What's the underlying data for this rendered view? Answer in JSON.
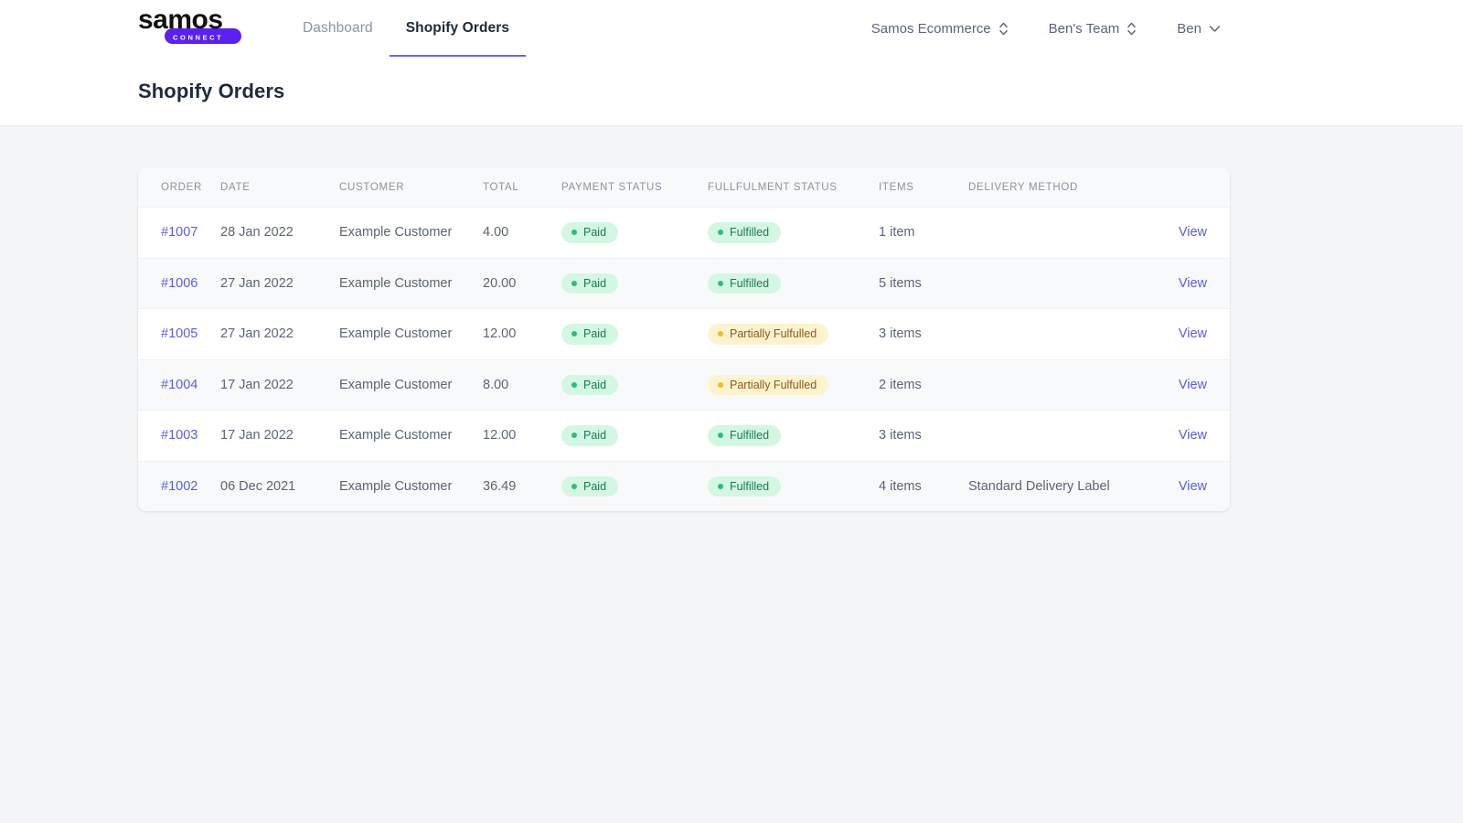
{
  "brand": {
    "name": "samos",
    "tagline": "C O N N E C T",
    "tagline_plain": "CONNECT",
    "logo_purple": "#5b21f0"
  },
  "nav": {
    "tabs": [
      {
        "label": "Dashboard",
        "active": false
      },
      {
        "label": "Shopify Orders",
        "active": true
      }
    ],
    "active_underline_color": "#6366f1"
  },
  "account": {
    "store_selector": {
      "label": "Samos Ecommerce",
      "icon": "up-down-chevron-icon"
    },
    "team_selector": {
      "label": "Ben's Team",
      "icon": "up-down-chevron-icon"
    },
    "user_menu": {
      "label": "Ben",
      "icon": "chevron-down-icon"
    }
  },
  "page": {
    "title": "Shopify Orders"
  },
  "table": {
    "columns": [
      "ORDER",
      "DATE",
      "CUSTOMER",
      "TOTAL",
      "PAYMENT STATUS",
      "FULLFULMENT STATUS",
      "ITEMS",
      "DELIVERY METHOD",
      ""
    ],
    "action_label": "View",
    "rows": [
      {
        "order": "#1007",
        "date": "28 Jan 2022",
        "customer": "Example Customer",
        "total": "4.00",
        "payment_status": "Paid",
        "payment_tone": "green",
        "fulfilment_status": "Fulfilled",
        "fulfilment_tone": "green",
        "items": "1 item",
        "delivery_method": "",
        "action": "View"
      },
      {
        "order": "#1006",
        "date": "27 Jan 2022",
        "customer": "Example Customer",
        "total": "20.00",
        "payment_status": "Paid",
        "payment_tone": "green",
        "fulfilment_status": "Fulfilled",
        "fulfilment_tone": "green",
        "items": "5 items",
        "delivery_method": "",
        "action": "View"
      },
      {
        "order": "#1005",
        "date": "27 Jan 2022",
        "customer": "Example Customer",
        "total": "12.00",
        "payment_status": "Paid",
        "payment_tone": "green",
        "fulfilment_status": "Partially Fulfulled",
        "fulfilment_tone": "amber",
        "items": "3 items",
        "delivery_method": "",
        "action": "View"
      },
      {
        "order": "#1004",
        "date": "17 Jan 2022",
        "customer": "Example Customer",
        "total": "8.00",
        "payment_status": "Paid",
        "payment_tone": "green",
        "fulfilment_status": "Partially Fulfulled",
        "fulfilment_tone": "amber",
        "items": "2 items",
        "delivery_method": "",
        "action": "View"
      },
      {
        "order": "#1003",
        "date": "17 Jan 2022",
        "customer": "Example Customer",
        "total": "12.00",
        "payment_status": "Paid",
        "payment_tone": "green",
        "fulfilment_status": "Fulfilled",
        "fulfilment_tone": "green",
        "items": "3 items",
        "delivery_method": "",
        "action": "View"
      },
      {
        "order": "#1002",
        "date": "06 Dec 2021",
        "customer": "Example Customer",
        "total": "36.49",
        "payment_status": "Paid",
        "payment_tone": "green",
        "fulfilment_status": "Fulfilled",
        "fulfilment_tone": "green",
        "items": "4 items",
        "delivery_method": "Standard Delivery Label",
        "action": "View"
      }
    ]
  },
  "colors": {
    "accent_link": "#5b5ce2",
    "badge_green_bg": "#d4f7e4",
    "badge_green_text": "#1d7a52",
    "badge_amber_bg": "#fdf3cf",
    "badge_amber_text": "#8a5a1c",
    "page_bg": "#f4f5f7",
    "card_bg": "#ffffff"
  }
}
